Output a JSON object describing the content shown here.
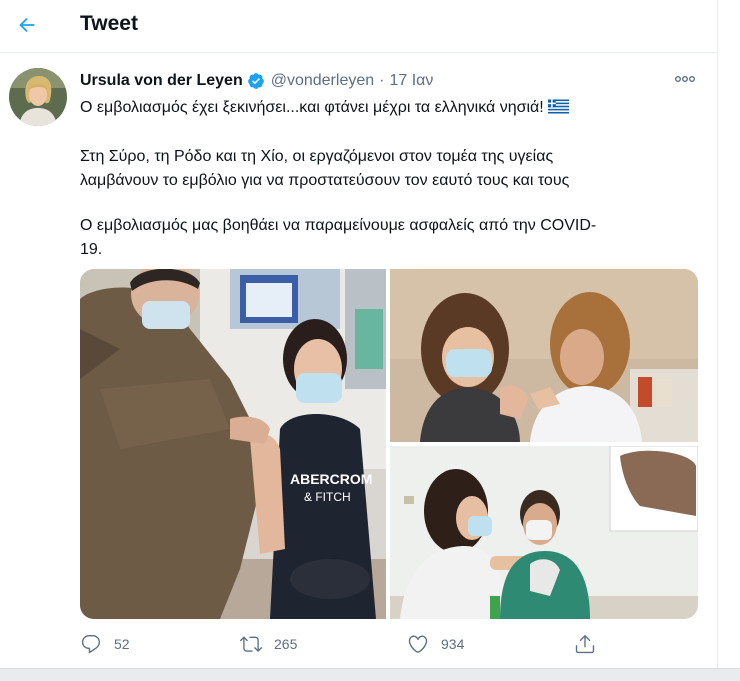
{
  "header": {
    "title": "Tweet",
    "back_icon": "arrow-left-icon"
  },
  "tweet": {
    "author_name": "Ursula von der Leyen",
    "handle": "@vonderleyen",
    "separator": "·",
    "date": "17 Ιαν",
    "verified": true,
    "line1": "Ο εμβολιασμός έχει ξεκινήσει...και φτάνει μέχρι τα ελληνικά νησιά!",
    "para2_line1": "Στη Σύρο, τη Ρόδο και τη Χίο, οι εργαζόμενοι στον τομέα της υγείας",
    "para2_line2": "λαμβάνουν το εμβόλιο για να προστατεύσουν τον εαυτό τους και τους",
    "para3_line1": "Ο εμβολιασμός μας βοηθάει να παραμείνουμε ασφαλείς από την COVID-",
    "para3_line2": "19.",
    "flag_icon": "greek-flag-icon"
  },
  "actions": {
    "replies": "52",
    "retweets": "265",
    "likes": "934"
  },
  "colors": {
    "accent": "#1da1f2",
    "text": "#0f1419",
    "muted": "#5b7083",
    "divider": "#e6ecf0"
  }
}
